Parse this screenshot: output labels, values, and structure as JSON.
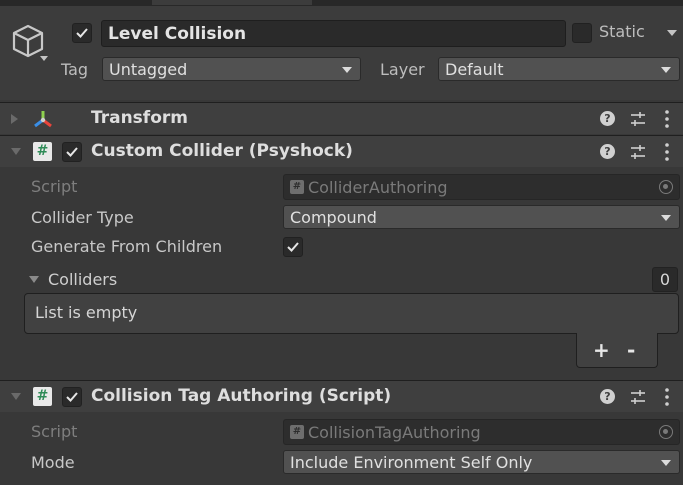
{
  "header": {
    "name": "Level Collision",
    "active": true,
    "static_label": "Static",
    "tag_label": "Tag",
    "tag_value": "Untagged",
    "layer_label": "Layer",
    "layer_value": "Default"
  },
  "components": {
    "transform": {
      "title": "Transform"
    },
    "custom_collider": {
      "title": "Custom Collider (Psyshock)",
      "script_label": "Script",
      "script_value": "ColliderAuthoring",
      "collider_type_label": "Collider Type",
      "collider_type_value": "Compound",
      "generate_label": "Generate From Children",
      "generate_checked": true,
      "colliders_label": "Colliders",
      "colliders_count": "0",
      "empty_text": "List is empty",
      "add_label": "+",
      "remove_label": "-"
    },
    "collision_tag": {
      "title": "Collision Tag Authoring (Script)",
      "script_label": "Script",
      "script_value": "CollisionTagAuthoring",
      "mode_label": "Mode",
      "mode_value": "Include Environment Self Only"
    }
  },
  "icons": {
    "gameobject": "cube-icon",
    "transform": "transform-axes-icon",
    "script": "hash-script-icon",
    "help": "help-icon",
    "presets": "sliders-icon",
    "menu": "kebab-menu-icon"
  },
  "colors": {
    "background": "#383838",
    "header_bg": "#3c3c3c",
    "field_bg": "#2a2a2a",
    "dropdown_bg": "#515151",
    "script_icon_green": "#2e8b57"
  }
}
